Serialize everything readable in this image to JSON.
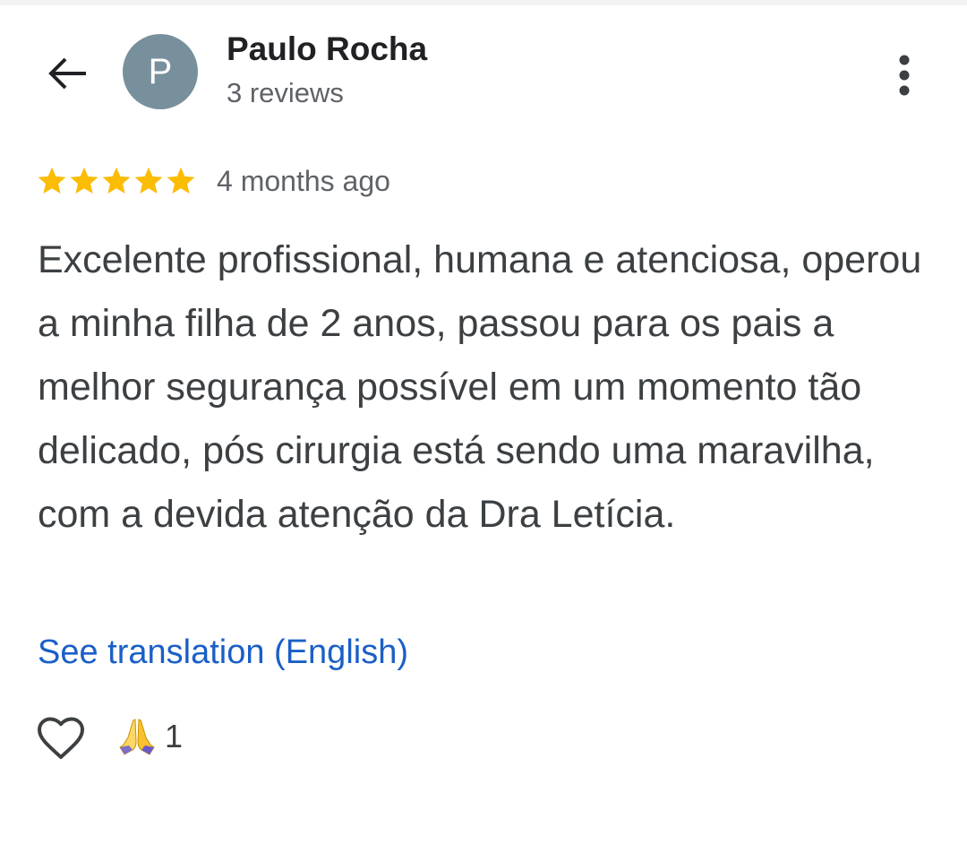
{
  "header": {
    "avatar_letter": "P",
    "user_name": "Paulo Rocha",
    "review_count": "3 reviews",
    "back_icon": "arrow-left-icon",
    "more_icon": "more-vert-icon"
  },
  "review": {
    "rating": 5,
    "rating_max": 5,
    "time_ago": "4 months ago",
    "text": "Excelente profissional, humana e atenciosa, operou a minha filha de 2 anos, passou para os pais a melhor segurança possível em um momento tão delicado, pós cirurgia está sendo uma maravilha, com a devida atenção da Dra Letícia.",
    "translate_label": "See translation (English)"
  },
  "reactions": {
    "like_icon": "heart-outline-icon",
    "emoji": "🙏",
    "emoji_icon": "folded-hands-icon",
    "count": "1"
  },
  "colors": {
    "star": "#fbbc04",
    "avatar": "#78909c",
    "link": "#1a5fc7",
    "text": "#3c4043",
    "secondary": "#5f6368"
  }
}
